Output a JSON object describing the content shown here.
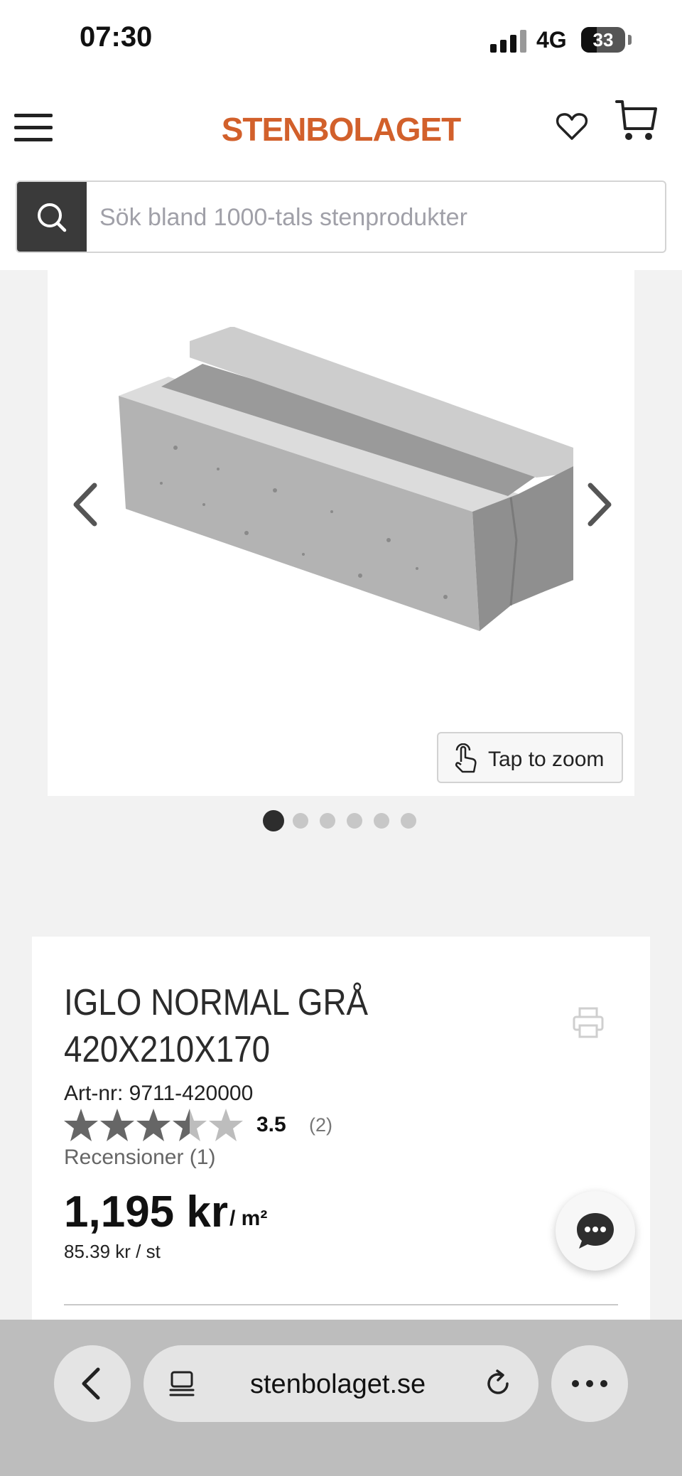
{
  "status_bar": {
    "time": "07:30",
    "network": "4G",
    "battery": "33"
  },
  "header": {
    "logo": "STENBOLAGET",
    "menu_icon": "hamburger-menu-icon",
    "wishlist_icon": "heart-icon",
    "cart_icon": "cart-icon"
  },
  "search": {
    "placeholder": "Sök bland 1000-tals stenprodukter",
    "icon": "search-icon"
  },
  "gallery": {
    "zoom_label": "Tap to zoom",
    "image_count": 6,
    "active_image": 1
  },
  "product": {
    "title_line1": "IGLO NORMAL GRÅ",
    "title_line2": "420X210X170",
    "art_nr": "Art-nr: 9711-420000",
    "rating": "3.5",
    "rating_count": "(2)",
    "reviews": "Recensioner (1)",
    "price": "1,195 kr",
    "unit": "/ m²",
    "per_piece": "85.39 kr / st"
  },
  "browser": {
    "url": "stenbolaget.se"
  },
  "colors": {
    "brand": "#d2602b",
    "search_button": "#3a3a3a"
  }
}
